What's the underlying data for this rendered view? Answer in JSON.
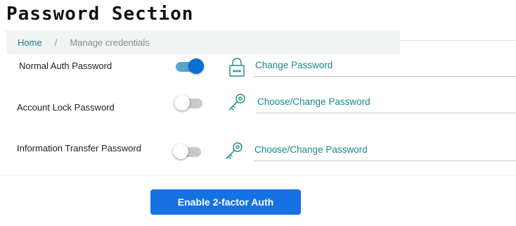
{
  "page": {
    "title": "Password Section"
  },
  "breadcrumb": {
    "home": "Home",
    "separator": "/",
    "current": "Manage credentials"
  },
  "rows": [
    {
      "label": "Normal Auth Password",
      "toggle_on": true,
      "icon": "lock-icon",
      "link": "Change Password"
    },
    {
      "label": "Account Lock Password",
      "toggle_on": false,
      "icon": "key-icon",
      "link": "Choose/Change Password"
    },
    {
      "label": "Information Transfer Password",
      "toggle_on": false,
      "icon": "key-icon",
      "link": "Choose/Change Password"
    }
  ],
  "actions": {
    "enable_2fa_label": "Enable 2-factor Auth"
  },
  "colors": {
    "accent": "#1671e3",
    "link": "#1a8a86",
    "toggle_on": "#0a6fd6"
  }
}
